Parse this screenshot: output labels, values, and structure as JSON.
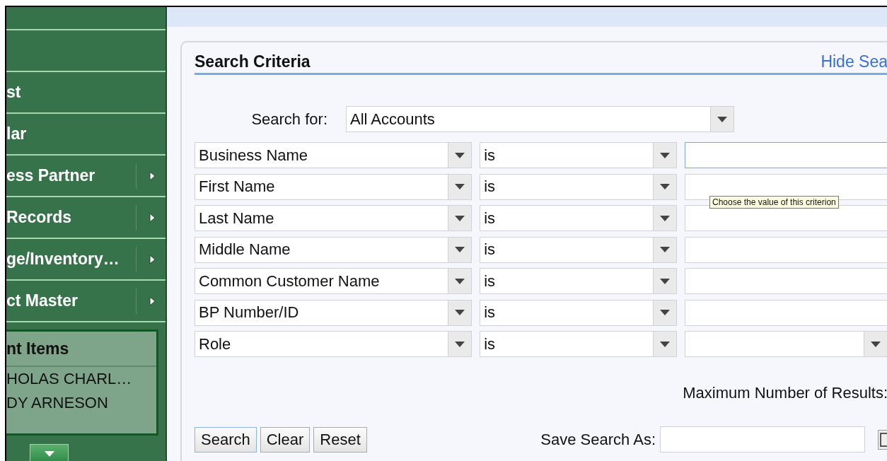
{
  "sidebar": {
    "items": [
      {
        "has_submenu": false
      },
      {
        "has_submenu": false
      },
      {
        "label": "st",
        "has_submenu": false
      },
      {
        "label": "lar",
        "has_submenu": false
      },
      {
        "label": "ess Partner",
        "has_submenu": true
      },
      {
        "label": "Records",
        "has_submenu": true
      },
      {
        "label": "ge/Inventory…",
        "has_submenu": true
      },
      {
        "label": "ct Master",
        "has_submenu": true
      }
    ],
    "recent": {
      "title": "nt Items",
      "items": [
        "HOLAS CHARL…",
        "DY ARNESON"
      ]
    }
  },
  "search_criteria": {
    "title": "Search Criteria",
    "hide_link": "Hide Sea",
    "search_for": {
      "label": "Search for:",
      "value": "All Accounts"
    },
    "criteria": [
      {
        "field": "Business Name",
        "operator": "is",
        "kind": "text",
        "focused": true
      },
      {
        "field": "First Name",
        "operator": "is",
        "kind": "text",
        "focused": false
      },
      {
        "field": "Last Name",
        "operator": "is",
        "kind": "text",
        "focused": false
      },
      {
        "field": "Middle Name",
        "operator": "is",
        "kind": "text",
        "focused": false
      },
      {
        "field": "Common Customer Name",
        "operator": "is",
        "kind": "text",
        "focused": false
      },
      {
        "field": "BP Number/ID",
        "operator": "is",
        "kind": "text",
        "focused": false
      },
      {
        "field": "Role",
        "operator": "is",
        "kind": "select",
        "focused": false
      }
    ],
    "tooltip": "Choose the value of this criterion",
    "max_results_label": "Maximum Number of Results:",
    "buttons": [
      "Search",
      "Clear",
      "Reset"
    ],
    "save_search_label": "Save Search As:"
  }
}
